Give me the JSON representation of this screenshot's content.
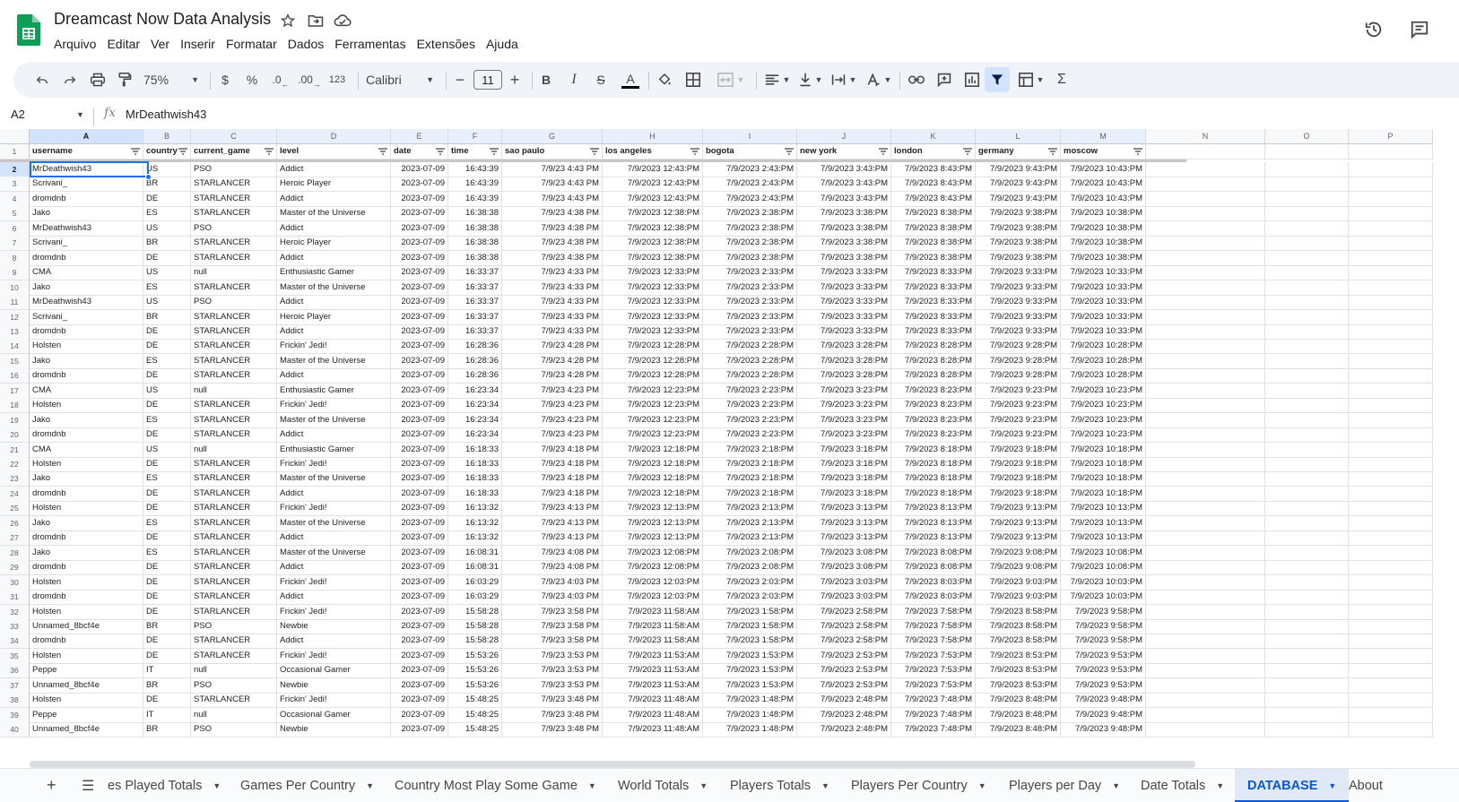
{
  "app": {
    "title": "Dreamcast Now Data Analysis",
    "menus": [
      "Arquivo",
      "Editar",
      "Ver",
      "Inserir",
      "Formatar",
      "Dados",
      "Ferramentas",
      "Extensões",
      "Ajuda"
    ]
  },
  "toolbar": {
    "zoom": "75%",
    "currency": "$",
    "percent": "%",
    "dec_decrease": ".0",
    "dec_increase": ".00",
    "number_format": "123",
    "font": "Calibri",
    "font_size": "11",
    "bold": "B",
    "italic": "I",
    "strike": "S",
    "text_color": "A",
    "sum": "Σ"
  },
  "formula_bar": {
    "cell_ref": "A2",
    "fx": "fx",
    "value": "MrDeathwish43"
  },
  "columns": [
    "A",
    "B",
    "C",
    "D",
    "E",
    "F",
    "G",
    "H",
    "I",
    "J",
    "K",
    "L",
    "M",
    "N",
    "O",
    "P"
  ],
  "headers": [
    "username",
    "country",
    "current_game",
    "level",
    "date",
    "time",
    "sao paulo",
    "los angeles",
    "bogota",
    "new york",
    "london",
    "germany",
    "moscow"
  ],
  "rows": [
    [
      "MrDeathwish43",
      "US",
      "PSO",
      "Addict",
      "2023-07-09",
      "16:43:39",
      "7/9/23 4:43 PM",
      "7/9/2023 12:43:PM",
      "7/9/2023 2:43:PM",
      "7/9/2023 3:43:PM",
      "7/9/2023 8:43:PM",
      "7/9/2023 9:43:PM",
      "7/9/2023 10:43:PM"
    ],
    [
      "Scrivani_",
      "BR",
      "STARLANCER",
      "Heroic Player",
      "2023-07-09",
      "16:43:39",
      "7/9/23 4:43 PM",
      "7/9/2023 12:43:PM",
      "7/9/2023 2:43:PM",
      "7/9/2023 3:43:PM",
      "7/9/2023 8:43:PM",
      "7/9/2023 9:43:PM",
      "7/9/2023 10:43:PM"
    ],
    [
      "dromdnb",
      "DE",
      "STARLANCER",
      "Addict",
      "2023-07-09",
      "16:43:39",
      "7/9/23 4:43 PM",
      "7/9/2023 12:43:PM",
      "7/9/2023 2:43:PM",
      "7/9/2023 3:43:PM",
      "7/9/2023 8:43:PM",
      "7/9/2023 9:43:PM",
      "7/9/2023 10:43:PM"
    ],
    [
      "Jako",
      "ES",
      "STARLANCER",
      "Master of the Universe",
      "2023-07-09",
      "16:38:38",
      "7/9/23 4:38 PM",
      "7/9/2023 12:38:PM",
      "7/9/2023 2:38:PM",
      "7/9/2023 3:38:PM",
      "7/9/2023 8:38:PM",
      "7/9/2023 9:38:PM",
      "7/9/2023 10:38:PM"
    ],
    [
      "MrDeathwish43",
      "US",
      "PSO",
      "Addict",
      "2023-07-09",
      "16:38:38",
      "7/9/23 4:38 PM",
      "7/9/2023 12:38:PM",
      "7/9/2023 2:38:PM",
      "7/9/2023 3:38:PM",
      "7/9/2023 8:38:PM",
      "7/9/2023 9:38:PM",
      "7/9/2023 10:38:PM"
    ],
    [
      "Scrivani_",
      "BR",
      "STARLANCER",
      "Heroic Player",
      "2023-07-09",
      "16:38:38",
      "7/9/23 4:38 PM",
      "7/9/2023 12:38:PM",
      "7/9/2023 2:38:PM",
      "7/9/2023 3:38:PM",
      "7/9/2023 8:38:PM",
      "7/9/2023 9:38:PM",
      "7/9/2023 10:38:PM"
    ],
    [
      "dromdnb",
      "DE",
      "STARLANCER",
      "Addict",
      "2023-07-09",
      "16:38:38",
      "7/9/23 4:38 PM",
      "7/9/2023 12:38:PM",
      "7/9/2023 2:38:PM",
      "7/9/2023 3:38:PM",
      "7/9/2023 8:38:PM",
      "7/9/2023 9:38:PM",
      "7/9/2023 10:38:PM"
    ],
    [
      "CMA",
      "US",
      "null",
      "Enthusiastic Gamer",
      "2023-07-09",
      "16:33:37",
      "7/9/23 4:33 PM",
      "7/9/2023 12:33:PM",
      "7/9/2023 2:33:PM",
      "7/9/2023 3:33:PM",
      "7/9/2023 8:33:PM",
      "7/9/2023 9:33:PM",
      "7/9/2023 10:33:PM"
    ],
    [
      "Jako",
      "ES",
      "STARLANCER",
      "Master of the Universe",
      "2023-07-09",
      "16:33:37",
      "7/9/23 4:33 PM",
      "7/9/2023 12:33:PM",
      "7/9/2023 2:33:PM",
      "7/9/2023 3:33:PM",
      "7/9/2023 8:33:PM",
      "7/9/2023 9:33:PM",
      "7/9/2023 10:33:PM"
    ],
    [
      "MrDeathwish43",
      "US",
      "PSO",
      "Addict",
      "2023-07-09",
      "16:33:37",
      "7/9/23 4:33 PM",
      "7/9/2023 12:33:PM",
      "7/9/2023 2:33:PM",
      "7/9/2023 3:33:PM",
      "7/9/2023 8:33:PM",
      "7/9/2023 9:33:PM",
      "7/9/2023 10:33:PM"
    ],
    [
      "Scrivani_",
      "BR",
      "STARLANCER",
      "Heroic Player",
      "2023-07-09",
      "16:33:37",
      "7/9/23 4:33 PM",
      "7/9/2023 12:33:PM",
      "7/9/2023 2:33:PM",
      "7/9/2023 3:33:PM",
      "7/9/2023 8:33:PM",
      "7/9/2023 9:33:PM",
      "7/9/2023 10:33:PM"
    ],
    [
      "dromdnb",
      "DE",
      "STARLANCER",
      "Addict",
      "2023-07-09",
      "16:33:37",
      "7/9/23 4:33 PM",
      "7/9/2023 12:33:PM",
      "7/9/2023 2:33:PM",
      "7/9/2023 3:33:PM",
      "7/9/2023 8:33:PM",
      "7/9/2023 9:33:PM",
      "7/9/2023 10:33:PM"
    ],
    [
      "Holsten",
      "DE",
      "STARLANCER",
      "Frickin' Jedi!",
      "2023-07-09",
      "16:28:36",
      "7/9/23 4:28 PM",
      "7/9/2023 12:28:PM",
      "7/9/2023 2:28:PM",
      "7/9/2023 3:28:PM",
      "7/9/2023 8:28:PM",
      "7/9/2023 9:28:PM",
      "7/9/2023 10:28:PM"
    ],
    [
      "Jako",
      "ES",
      "STARLANCER",
      "Master of the Universe",
      "2023-07-09",
      "16:28:36",
      "7/9/23 4:28 PM",
      "7/9/2023 12:28:PM",
      "7/9/2023 2:28:PM",
      "7/9/2023 3:28:PM",
      "7/9/2023 8:28:PM",
      "7/9/2023 9:28:PM",
      "7/9/2023 10:28:PM"
    ],
    [
      "dromdnb",
      "DE",
      "STARLANCER",
      "Addict",
      "2023-07-09",
      "16:28:36",
      "7/9/23 4:28 PM",
      "7/9/2023 12:28:PM",
      "7/9/2023 2:28:PM",
      "7/9/2023 3:28:PM",
      "7/9/2023 8:28:PM",
      "7/9/2023 9:28:PM",
      "7/9/2023 10:28:PM"
    ],
    [
      "CMA",
      "US",
      "null",
      "Enthusiastic Gamer",
      "2023-07-09",
      "16:23:34",
      "7/9/23 4:23 PM",
      "7/9/2023 12:23:PM",
      "7/9/2023 2:23:PM",
      "7/9/2023 3:23:PM",
      "7/9/2023 8:23:PM",
      "7/9/2023 9:23:PM",
      "7/9/2023 10:23:PM"
    ],
    [
      "Holsten",
      "DE",
      "STARLANCER",
      "Frickin' Jedi!",
      "2023-07-09",
      "16:23:34",
      "7/9/23 4:23 PM",
      "7/9/2023 12:23:PM",
      "7/9/2023 2:23:PM",
      "7/9/2023 3:23:PM",
      "7/9/2023 8:23:PM",
      "7/9/2023 9:23:PM",
      "7/9/2023 10:23:PM"
    ],
    [
      "Jako",
      "ES",
      "STARLANCER",
      "Master of the Universe",
      "2023-07-09",
      "16:23:34",
      "7/9/23 4:23 PM",
      "7/9/2023 12:23:PM",
      "7/9/2023 2:23:PM",
      "7/9/2023 3:23:PM",
      "7/9/2023 8:23:PM",
      "7/9/2023 9:23:PM",
      "7/9/2023 10:23:PM"
    ],
    [
      "dromdnb",
      "DE",
      "STARLANCER",
      "Addict",
      "2023-07-09",
      "16:23:34",
      "7/9/23 4:23 PM",
      "7/9/2023 12:23:PM",
      "7/9/2023 2:23:PM",
      "7/9/2023 3:23:PM",
      "7/9/2023 8:23:PM",
      "7/9/2023 9:23:PM",
      "7/9/2023 10:23:PM"
    ],
    [
      "CMA",
      "US",
      "null",
      "Enthusiastic Gamer",
      "2023-07-09",
      "16:18:33",
      "7/9/23 4:18 PM",
      "7/9/2023 12:18:PM",
      "7/9/2023 2:18:PM",
      "7/9/2023 3:18:PM",
      "7/9/2023 8:18:PM",
      "7/9/2023 9:18:PM",
      "7/9/2023 10:18:PM"
    ],
    [
      "Holsten",
      "DE",
      "STARLANCER",
      "Frickin' Jedi!",
      "2023-07-09",
      "16:18:33",
      "7/9/23 4:18 PM",
      "7/9/2023 12:18:PM",
      "7/9/2023 2:18:PM",
      "7/9/2023 3:18:PM",
      "7/9/2023 8:18:PM",
      "7/9/2023 9:18:PM",
      "7/9/2023 10:18:PM"
    ],
    [
      "Jako",
      "ES",
      "STARLANCER",
      "Master of the Universe",
      "2023-07-09",
      "16:18:33",
      "7/9/23 4:18 PM",
      "7/9/2023 12:18:PM",
      "7/9/2023 2:18:PM",
      "7/9/2023 3:18:PM",
      "7/9/2023 8:18:PM",
      "7/9/2023 9:18:PM",
      "7/9/2023 10:18:PM"
    ],
    [
      "dromdnb",
      "DE",
      "STARLANCER",
      "Addict",
      "2023-07-09",
      "16:18:33",
      "7/9/23 4:18 PM",
      "7/9/2023 12:18:PM",
      "7/9/2023 2:18:PM",
      "7/9/2023 3:18:PM",
      "7/9/2023 8:18:PM",
      "7/9/2023 9:18:PM",
      "7/9/2023 10:18:PM"
    ],
    [
      "Holsten",
      "DE",
      "STARLANCER",
      "Frickin' Jedi!",
      "2023-07-09",
      "16:13:32",
      "7/9/23 4:13 PM",
      "7/9/2023 12:13:PM",
      "7/9/2023 2:13:PM",
      "7/9/2023 3:13:PM",
      "7/9/2023 8:13:PM",
      "7/9/2023 9:13:PM",
      "7/9/2023 10:13:PM"
    ],
    [
      "Jako",
      "ES",
      "STARLANCER",
      "Master of the Universe",
      "2023-07-09",
      "16:13:32",
      "7/9/23 4:13 PM",
      "7/9/2023 12:13:PM",
      "7/9/2023 2:13:PM",
      "7/9/2023 3:13:PM",
      "7/9/2023 8:13:PM",
      "7/9/2023 9:13:PM",
      "7/9/2023 10:13:PM"
    ],
    [
      "dromdnb",
      "DE",
      "STARLANCER",
      "Addict",
      "2023-07-09",
      "16:13:32",
      "7/9/23 4:13 PM",
      "7/9/2023 12:13:PM",
      "7/9/2023 2:13:PM",
      "7/9/2023 3:13:PM",
      "7/9/2023 8:13:PM",
      "7/9/2023 9:13:PM",
      "7/9/2023 10:13:PM"
    ],
    [
      "Jako",
      "ES",
      "STARLANCER",
      "Master of the Universe",
      "2023-07-09",
      "16:08:31",
      "7/9/23 4:08 PM",
      "7/9/2023 12:08:PM",
      "7/9/2023 2:08:PM",
      "7/9/2023 3:08:PM",
      "7/9/2023 8:08:PM",
      "7/9/2023 9:08:PM",
      "7/9/2023 10:08:PM"
    ],
    [
      "dromdnb",
      "DE",
      "STARLANCER",
      "Addict",
      "2023-07-09",
      "16:08:31",
      "7/9/23 4:08 PM",
      "7/9/2023 12:08:PM",
      "7/9/2023 2:08:PM",
      "7/9/2023 3:08:PM",
      "7/9/2023 8:08:PM",
      "7/9/2023 9:08:PM",
      "7/9/2023 10:08:PM"
    ],
    [
      "Holsten",
      "DE",
      "STARLANCER",
      "Frickin' Jedi!",
      "2023-07-09",
      "16:03:29",
      "7/9/23 4:03 PM",
      "7/9/2023 12:03:PM",
      "7/9/2023 2:03:PM",
      "7/9/2023 3:03:PM",
      "7/9/2023 8:03:PM",
      "7/9/2023 9:03:PM",
      "7/9/2023 10:03:PM"
    ],
    [
      "dromdnb",
      "DE",
      "STARLANCER",
      "Addict",
      "2023-07-09",
      "16:03:29",
      "7/9/23 4:03 PM",
      "7/9/2023 12:03:PM",
      "7/9/2023 2:03:PM",
      "7/9/2023 3:03:PM",
      "7/9/2023 8:03:PM",
      "7/9/2023 9:03:PM",
      "7/9/2023 10:03:PM"
    ],
    [
      "Holsten",
      "DE",
      "STARLANCER",
      "Frickin' Jedi!",
      "2023-07-09",
      "15:58:28",
      "7/9/23 3:58 PM",
      "7/9/2023 11:58:AM",
      "7/9/2023 1:58:PM",
      "7/9/2023 2:58:PM",
      "7/9/2023 7:58:PM",
      "7/9/2023 8:58:PM",
      "7/9/2023 9:58:PM"
    ],
    [
      "Unnamed_8bcf4e",
      "BR",
      "PSO",
      "Newbie",
      "2023-07-09",
      "15:58:28",
      "7/9/23 3:58 PM",
      "7/9/2023 11:58:AM",
      "7/9/2023 1:58:PM",
      "7/9/2023 2:58:PM",
      "7/9/2023 7:58:PM",
      "7/9/2023 8:58:PM",
      "7/9/2023 9:58:PM"
    ],
    [
      "dromdnb",
      "DE",
      "STARLANCER",
      "Addict",
      "2023-07-09",
      "15:58:28",
      "7/9/23 3:58 PM",
      "7/9/2023 11:58:AM",
      "7/9/2023 1:58:PM",
      "7/9/2023 2:58:PM",
      "7/9/2023 7:58:PM",
      "7/9/2023 8:58:PM",
      "7/9/2023 9:58:PM"
    ],
    [
      "Holsten",
      "DE",
      "STARLANCER",
      "Frickin' Jedi!",
      "2023-07-09",
      "15:53:26",
      "7/9/23 3:53 PM",
      "7/9/2023 11:53:AM",
      "7/9/2023 1:53:PM",
      "7/9/2023 2:53:PM",
      "7/9/2023 7:53:PM",
      "7/9/2023 8:53:PM",
      "7/9/2023 9:53:PM"
    ],
    [
      "Peppe",
      "IT",
      "null",
      "Occasional Gamer",
      "2023-07-09",
      "15:53:26",
      "7/9/23 3:53 PM",
      "7/9/2023 11:53:AM",
      "7/9/2023 1:53:PM",
      "7/9/2023 2:53:PM",
      "7/9/2023 7:53:PM",
      "7/9/2023 8:53:PM",
      "7/9/2023 9:53:PM"
    ],
    [
      "Unnamed_8bcf4e",
      "BR",
      "PSO",
      "Newbie",
      "2023-07-09",
      "15:53:26",
      "7/9/23 3:53 PM",
      "7/9/2023 11:53:AM",
      "7/9/2023 1:53:PM",
      "7/9/2023 2:53:PM",
      "7/9/2023 7:53:PM",
      "7/9/2023 8:53:PM",
      "7/9/2023 9:53:PM"
    ],
    [
      "Holsten",
      "DE",
      "STARLANCER",
      "Frickin' Jedi!",
      "2023-07-09",
      "15:48:25",
      "7/9/23 3:48 PM",
      "7/9/2023 11:48:AM",
      "7/9/2023 1:48:PM",
      "7/9/2023 2:48:PM",
      "7/9/2023 7:48:PM",
      "7/9/2023 8:48:PM",
      "7/9/2023 9:48:PM"
    ],
    [
      "Peppe",
      "IT",
      "null",
      "Occasional Gamer",
      "2023-07-09",
      "15:48:25",
      "7/9/23 3:48 PM",
      "7/9/2023 11:48:AM",
      "7/9/2023 1:48:PM",
      "7/9/2023 2:48:PM",
      "7/9/2023 7:48:PM",
      "7/9/2023 8:48:PM",
      "7/9/2023 9:48:PM"
    ],
    [
      "Unnamed_8bcf4e",
      "BR",
      "PSO",
      "Newbie",
      "2023-07-09",
      "15:48:25",
      "7/9/23 3:48 PM",
      "7/9/2023 11:48:AM",
      "7/9/2023 1:48:PM",
      "7/9/2023 2:48:PM",
      "7/9/2023 7:48:PM",
      "7/9/2023 8:48:PM",
      "7/9/2023 9:48:PM"
    ]
  ],
  "tabs": [
    {
      "label": "es Played Totals",
      "active": false
    },
    {
      "label": "Games Per Country",
      "active": false
    },
    {
      "label": "Country Most Play Some Game",
      "active": false
    },
    {
      "label": "World Totals",
      "active": false
    },
    {
      "label": "Players Totals",
      "active": false
    },
    {
      "label": "Players Per Country",
      "active": false
    },
    {
      "label": "Players per Day",
      "active": false
    },
    {
      "label": "Date Totals",
      "active": false
    },
    {
      "label": "DATABASE",
      "active": true
    },
    {
      "label": "About",
      "active": false
    }
  ],
  "colors": {
    "sheets_green": "#0f9d58",
    "accent_blue": "#1a73e8",
    "active_tab_text": "#0b57d0",
    "toolbar_bg": "#f0f4f9"
  }
}
